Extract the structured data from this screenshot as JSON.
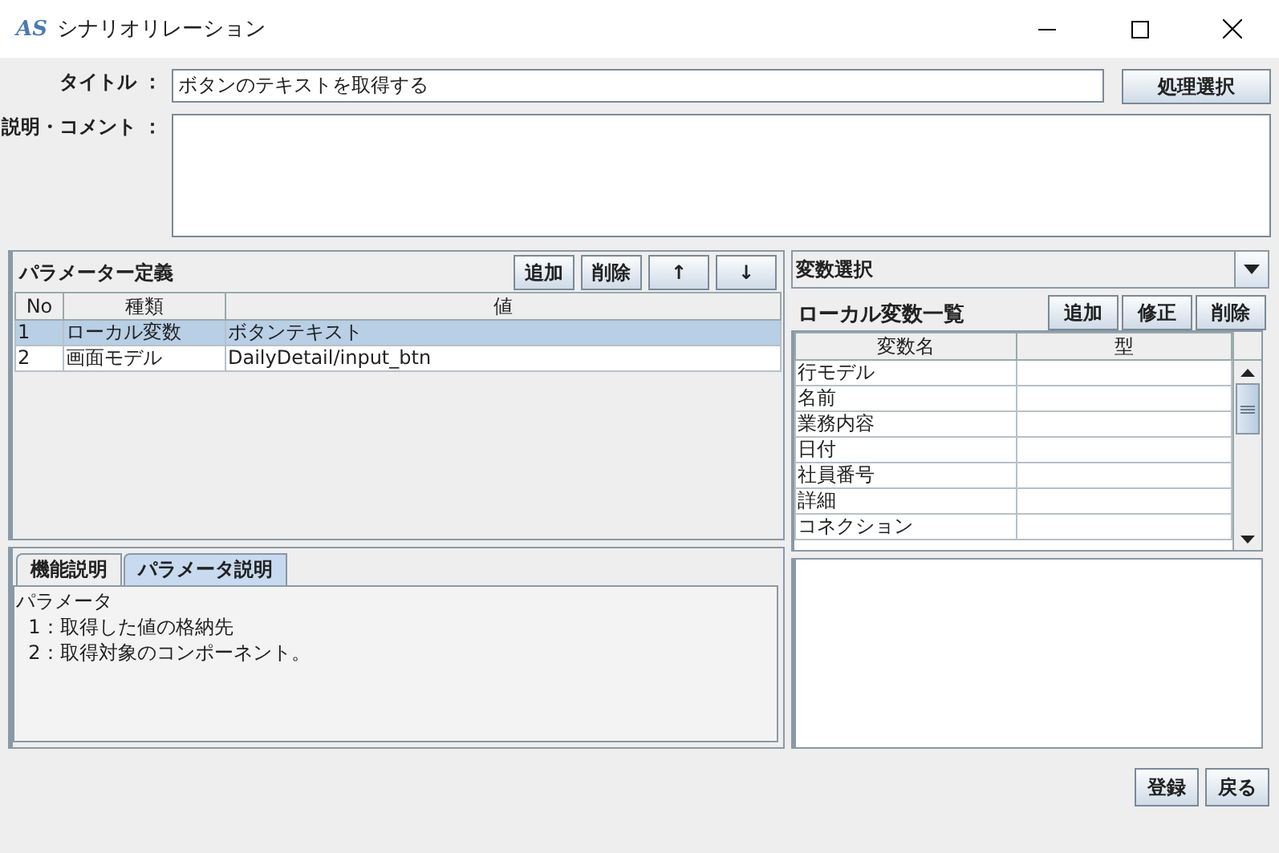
{
  "window": {
    "logo": "AS",
    "title": "シナリオリレーション"
  },
  "form": {
    "title_label": "タイトル ：",
    "title_value": "ボタンのテキストを取得する",
    "process_button": "処理選択",
    "comment_label": "説明・コメント ："
  },
  "parameters": {
    "title": "パラメーター定義",
    "buttons": [
      "追加",
      "削除",
      "↑",
      "↓"
    ],
    "columns": [
      "No",
      "種類",
      "値"
    ],
    "rows": [
      {
        "cells": [
          "1",
          "ローカル変数",
          "ボタンテキスト"
        ],
        "selected": true
      },
      {
        "cells": [
          "2",
          "画面モデル",
          "DailyDetail/input_btn"
        ],
        "selected": false
      }
    ]
  },
  "help": {
    "tabs": [
      {
        "label": "機能説明",
        "selected": false
      },
      {
        "label": "パラメータ説明",
        "selected": true
      }
    ],
    "text": "パラメータ\n  1：取得した値の格納先\n  2：取得対象のコンポーネント。"
  },
  "variables": {
    "selector": "変数選択",
    "list_title": "ローカル変数一覧",
    "buttons": [
      "追加",
      "修正",
      "削除"
    ],
    "columns": [
      "変数名",
      "型"
    ],
    "rows": [
      "行モデル",
      "名前",
      "業務内容",
      "日付",
      "社員番号",
      "詳細",
      "コネクション"
    ]
  },
  "footer": {
    "buttons": [
      "登録",
      "戻る"
    ]
  }
}
